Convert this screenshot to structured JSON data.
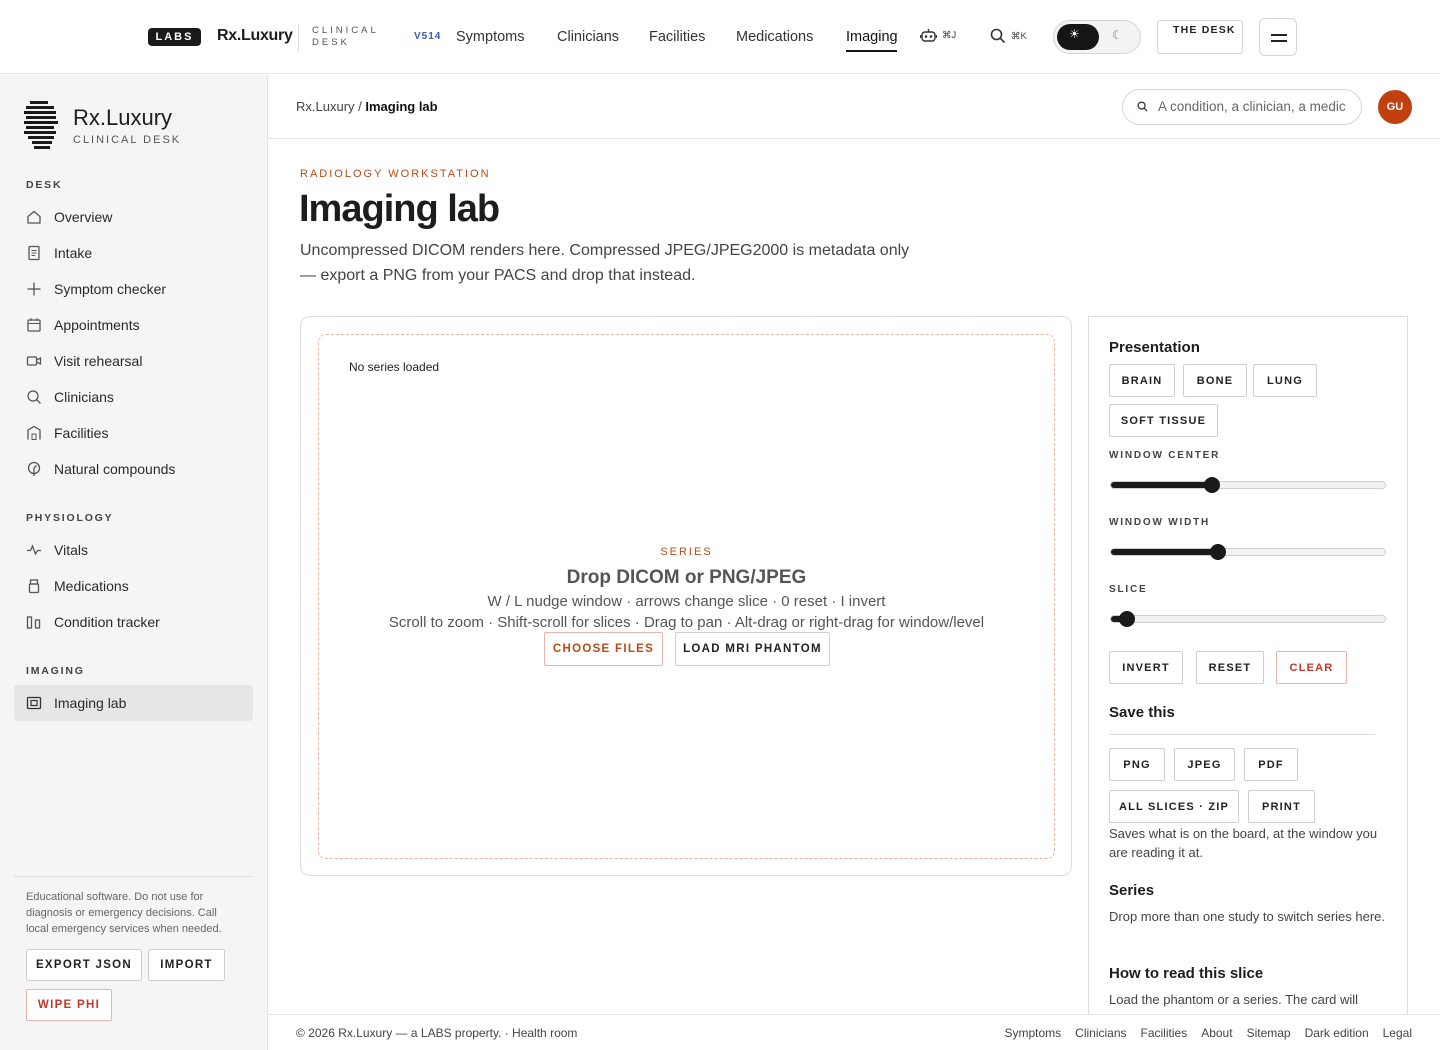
{
  "topbar": {
    "labs_badge": "LABS",
    "brand": "Rx.Luxury",
    "brand_sub": "CLINICAL DESK",
    "version": "V514",
    "nav": [
      "Symptoms",
      "Clinicians",
      "Facilities",
      "Medications",
      "Imaging"
    ],
    "active_nav": "Imaging",
    "assistant_shortcut": "⌘J",
    "search_shortcut": "⌘K",
    "desk_button": "THE DESK",
    "theme": "light"
  },
  "sidebar": {
    "brand": "Rx.Luxury",
    "brand_sub": "CLINICAL DESK",
    "sections": {
      "desk": "DESK",
      "physiology": "PHYSIOLOGY",
      "imaging": "IMAGING"
    },
    "desk_items": [
      "Overview",
      "Intake",
      "Symptom checker",
      "Appointments",
      "Visit rehearsal",
      "Clinicians",
      "Facilities",
      "Natural compounds"
    ],
    "physiology_items": [
      "Vitals",
      "Medications",
      "Condition tracker"
    ],
    "imaging_items": [
      "Imaging lab"
    ],
    "disclaimer": "Educational software. Do not use for diagnosis or emergency decisions. Call local emergency services when needed.",
    "export_json": "EXPORT JSON",
    "import": "IMPORT",
    "wipe_phi": "WIPE PHI"
  },
  "header": {
    "crumb_root": "Rx.Luxury",
    "crumb_sep": " / ",
    "crumb_current": "Imaging lab",
    "search_placeholder": "A condition, a clinician, a medic",
    "avatar_initials": "GU",
    "avatar_color": "#c0400f"
  },
  "page": {
    "eyebrow": "RADIOLOGY WORKSTATION",
    "title": "Imaging lab",
    "lede_1": "Uncompressed DICOM renders here. Compressed JPEG/JPEG2000 is metadata only",
    "lede_2": "— export a PNG from your PACS and drop that instead."
  },
  "viewer": {
    "status": "No series loaded",
    "eyebrow": "SERIES",
    "title": "Drop DICOM or PNG/JPEG",
    "hint_1": "W / L nudge window · arrows change slice · 0 reset · I invert",
    "hint_2": "Scroll to zoom · Shift-scroll for slices · Drag to pan · Alt-drag or right-drag for window/level",
    "choose_files": "CHOOSE FILES",
    "load_phantom": "LOAD MRI PHANTOM"
  },
  "panel": {
    "presentation_title": "Presentation",
    "presets": [
      "BRAIN",
      "BONE",
      "LUNG",
      "SOFT TISSUE"
    ],
    "window_center_label": "WINDOW CENTER",
    "window_center_fraction": 0.37,
    "window_width_label": "WINDOW WIDTH",
    "window_width_fraction": 0.39,
    "slice_label": "SLICE",
    "slice_fraction": 0.06,
    "invert": "INVERT",
    "reset": "RESET",
    "clear": "CLEAR",
    "save_title": "Save this",
    "save_formats": [
      "PNG",
      "JPEG",
      "PDF"
    ],
    "all_slices": "ALL SLICES · ZIP",
    "print": "PRINT",
    "save_note": "Saves what is on the board, at the window you are reading it at.",
    "series_title": "Series",
    "series_note": "Drop more than one study to switch series here.",
    "howto_title": "How to read this slice",
    "howto_note": "Load the phantom or a series. The card will"
  },
  "footer": {
    "copyright": "© 2026 Rx.Luxury — a LABS property. · Health room",
    "links": [
      "Symptoms",
      "Clinicians",
      "Facilities",
      "About",
      "Sitemap",
      "Dark edition",
      "Legal"
    ]
  },
  "colors": {
    "accent": "#b84a17",
    "danger": "#c0392b",
    "version": "#3b5bb8"
  }
}
